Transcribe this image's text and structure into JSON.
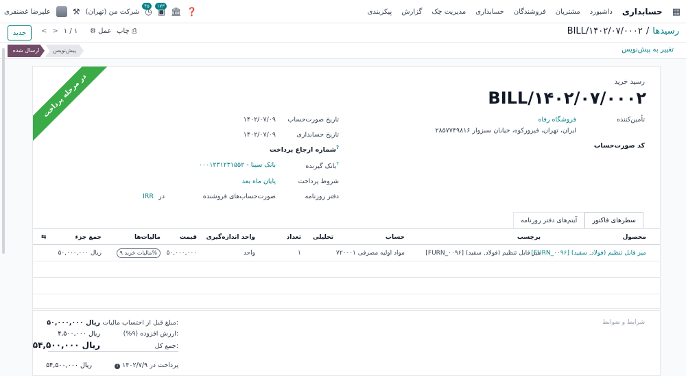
{
  "navbar": {
    "brand": "حسابداری",
    "menu": [
      "داشبورد",
      "مشتریان",
      "فروشندگان",
      "حسابداری",
      "مدیریت چک",
      "گزارش",
      "پیکربندی"
    ],
    "company": "شرکت من (تهران)",
    "user": "علیرضا غضنفری",
    "chat_badge": "۱۷۳",
    "activity_badge": "۴۵",
    "icons": [
      "apps-grid-icon",
      "help-icon",
      "building-icon",
      "chat-icon",
      "clock-icon",
      "tools-icon"
    ]
  },
  "control": {
    "new_label": "جدید",
    "pager_value": "۱ / ۱",
    "print_label": "چاپ",
    "action_label": "عمل",
    "breadcrumb_parent": "رسیدها",
    "breadcrumb_sep": "/",
    "breadcrumb_current": "BILL/۱۴۰۲/۰۷/۰۰۰۲"
  },
  "status": {
    "reset_draft_label": "تغییر به پیش‌نویس",
    "stage_posted": "ارسال شده",
    "stage_draft": "پیش‌نویس"
  },
  "ribbon": "در مرحله پرداخت",
  "doc": {
    "type_label": "رسید خرید",
    "name": "BILL/۱۴۰۲/۰۷/۰۰۰۲",
    "vendor_label": "تأمین‌کننده",
    "vendor_name": "فروشگاه رفاه",
    "vendor_address": "ایران، تهران، فیروزکوه، خیابان سبزوار ۲۸۵۷۷۴۹۸۱۶",
    "bill_ref_label": "کد صورت‌حساب",
    "invoice_date_label": "تاریخ صورت‌حساب",
    "invoice_date": "۱۴۰۲/۰۷/۰۹",
    "accounting_date_label": "تاریخ حسابداری",
    "accounting_date": "۱۴۰۲/۰۷/۰۹",
    "payment_ref_label": "شماره ارجاع پرداخت",
    "recipient_bank_label": "بانک گیرنده",
    "recipient_bank": "۰۰۰۱۲۳۱۲۳۱۵۵۲ - بانک سینا",
    "payment_terms_label": "شروط پرداخت",
    "payment_terms": "پایان ماه بعد",
    "journal_label": "دفتر روزنامه",
    "journal": "صورت‌حساب‌های فروشنده",
    "currency_in": "در",
    "currency": "IRR",
    "help_mark": "?"
  },
  "tabs": [
    "سطرهای فاکتور",
    "آیتم‌های دفتر روزنامه"
  ],
  "table": {
    "columns": [
      "محصول",
      "برچسب",
      "حساب",
      "تحلیلی",
      "تعداد",
      "واحد اندازه‌گیری",
      "قیمت",
      "مالیات‌ها",
      "جمع جزء"
    ],
    "rows": [
      {
        "product": "[FURN_۰۰۹۶] میز قابل تنظیم (فولاد, سفید)",
        "label": "[FURN_۰۰۹۶] میز قابل تنظیم (فولاد, سفید)",
        "account": "۷۲۰۰۰۱ مواد اولیه مصرفی",
        "analytic": "",
        "quantity": "۱",
        "uom": "واحد",
        "price": "۵۰,۰۰۰,۰۰۰",
        "tax": "مالیات خرید ۹%",
        "subtotal": "۵۰,۰۰۰,۰۰۰ ریال"
      }
    ]
  },
  "footer": {
    "terms_placeholder": "شرایط و ضوابط",
    "untaxed_label": "مبلغ قبل از احتساب مالیات:",
    "untaxed_value": "۵۰,۰۰۰,۰۰۰ ریال",
    "vat_label": "ارزش افزوده (۹%):",
    "vat_value": "۴,۵۰۰,۰۰۰ ریال",
    "total_label": "جمع کل:",
    "total_value": "۵۴,۵۰۰,۰۰۰ ریال",
    "paid_label": "پرداخت در ۱۴۰۲/۷/۹",
    "paid_value": "۵۴,۵۰۰,۰۰۰ ریال"
  }
}
